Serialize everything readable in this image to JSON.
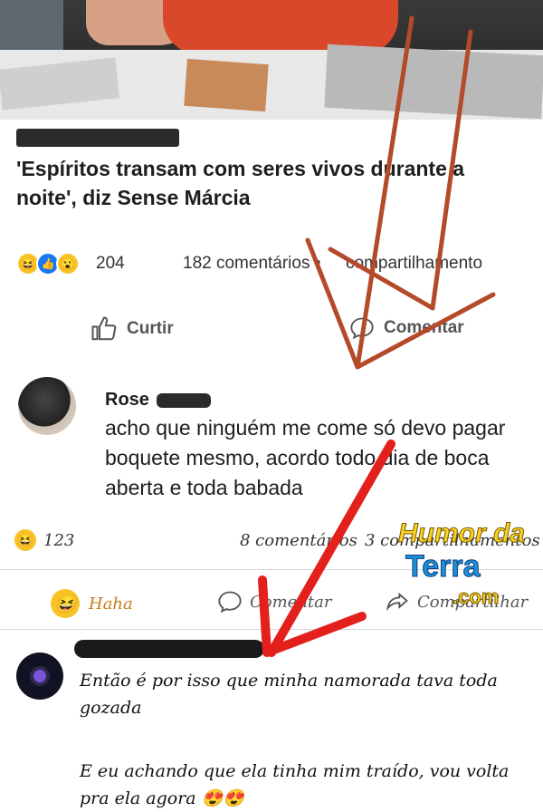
{
  "post": {
    "headline": "'Espíritos transam com seres vivos durante a noite', diz Sense Márcia",
    "reaction_count": "204",
    "comments_count": "182 comentários •",
    "shares_count": "compartilhamento",
    "like_label": "Curtir",
    "comment_label": "Comentar"
  },
  "comment1": {
    "author": "Rose",
    "text": "acho que ninguém me come só devo pagar boquete mesmo, acordo todo dia de boca aberta e toda babada",
    "reaction_count": "123",
    "comments_count": "8 comentários",
    "shares_count": "3 compartilhamentos",
    "haha_label": "Haha",
    "comment_label": "Comentar",
    "share_label": "Compartilhar"
  },
  "comment2": {
    "line1": "Então é por isso que minha namorada tava toda gozada",
    "line2": "E eu achando que ela tinha mim traído, vou volta pra ela agora 😍😍"
  },
  "watermark": {
    "line1": "Humor da",
    "line2": "Terra",
    "line3": ".com"
  },
  "icons": [
    "like-icon",
    "comment-icon",
    "share-icon",
    "haha-emoji-icon",
    "like-reaction-icon",
    "wow-emoji-icon"
  ],
  "colors": {
    "accent_arrow_red": "#e3201b",
    "arrow_brown": "#b44a2a",
    "haha_yellow": "#f7c325",
    "facebook_blue": "#1877f2"
  }
}
